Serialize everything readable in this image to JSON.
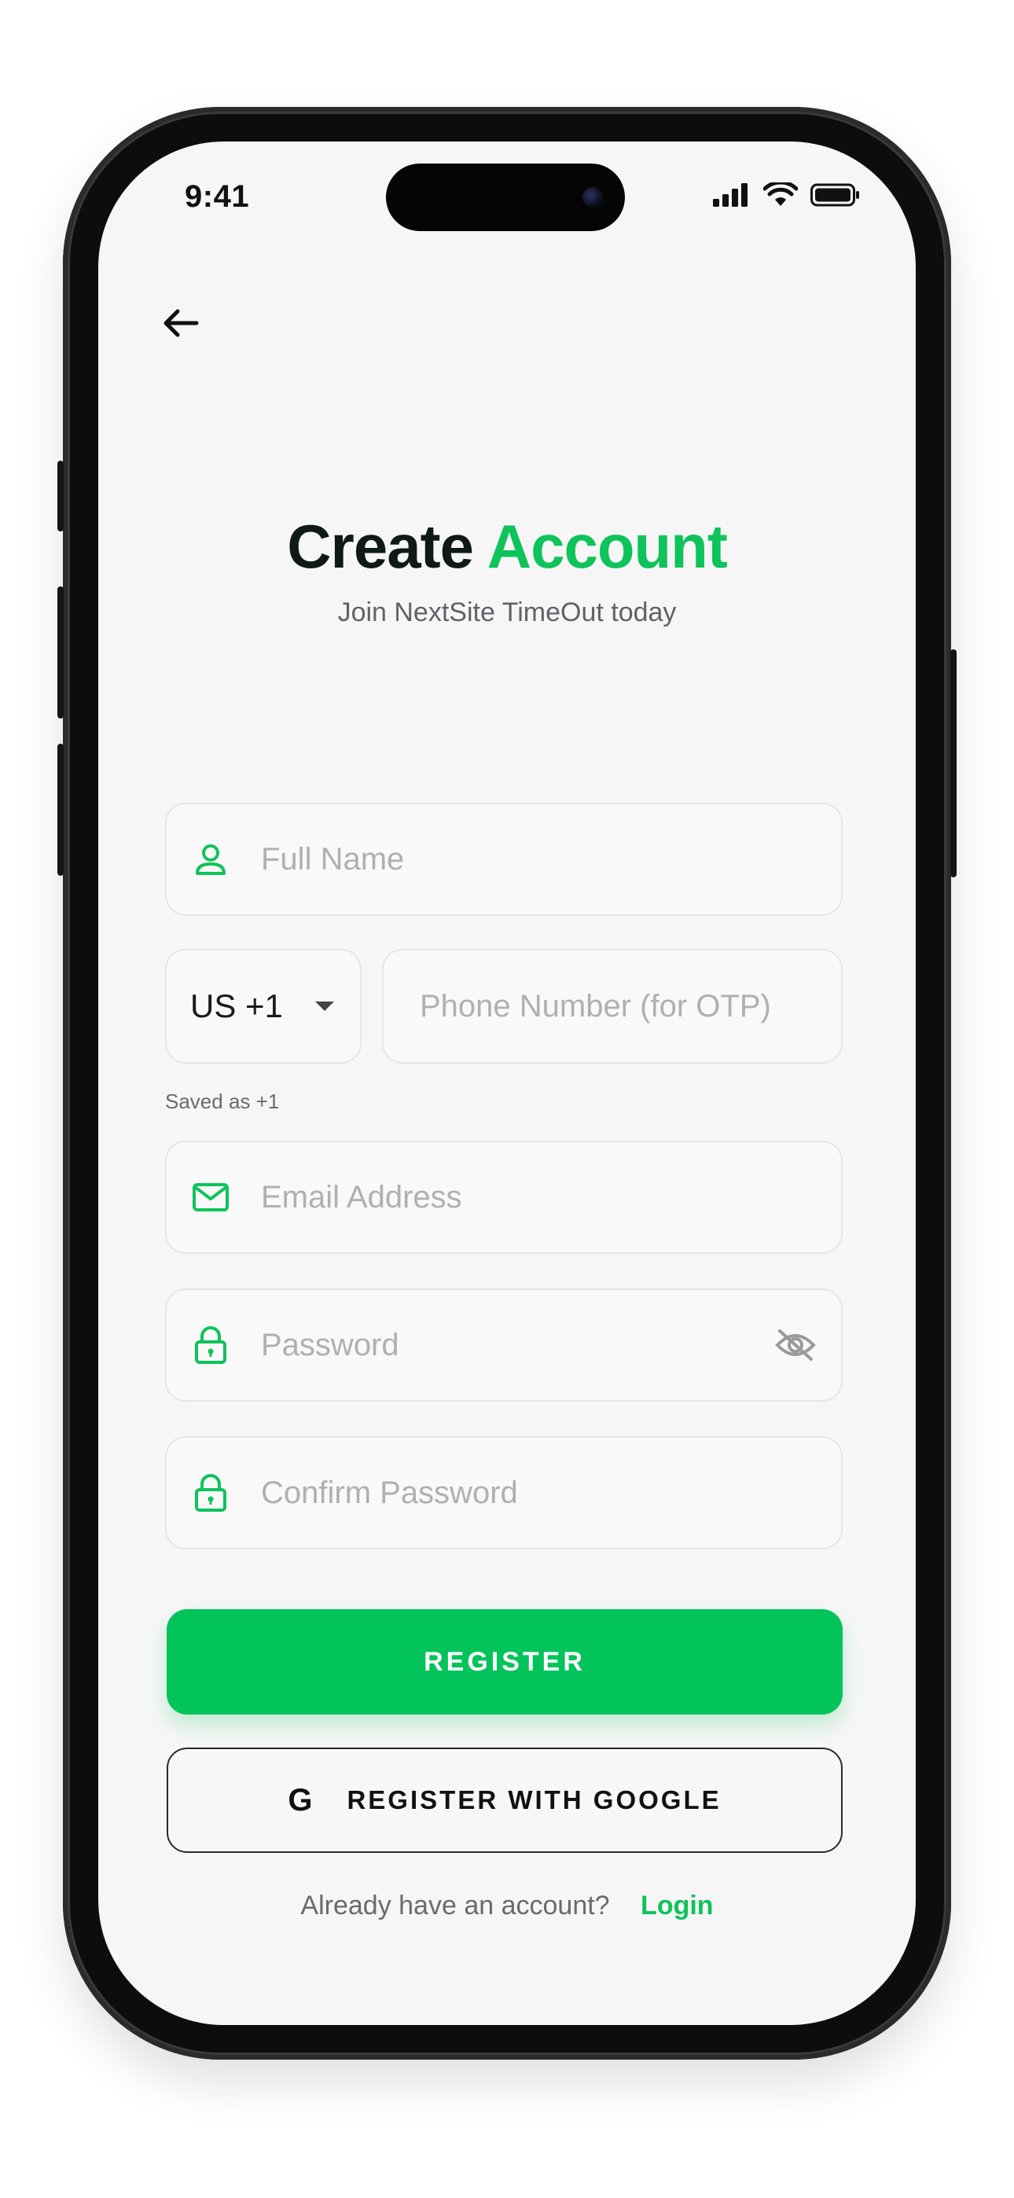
{
  "status_bar": {
    "time": "9:41"
  },
  "header": {
    "title_part1": "Create",
    "title_part2": "Account",
    "subtitle": "Join NextSite TimeOut today"
  },
  "form": {
    "full_name": {
      "placeholder": "Full Name",
      "value": ""
    },
    "country_code": {
      "selected": "US +1"
    },
    "phone": {
      "placeholder": "Phone Number (for OTP)",
      "value": ""
    },
    "phone_hint": "Saved as +1",
    "email": {
      "placeholder": "Email Address",
      "value": ""
    },
    "password": {
      "placeholder": "Password",
      "value": ""
    },
    "confirm_password": {
      "placeholder": "Confirm Password",
      "value": ""
    }
  },
  "actions": {
    "register_label": "REGISTER",
    "google_label": "REGISTER WITH GOOGLE",
    "google_glyph": "G"
  },
  "footer": {
    "question": "Already have an account?",
    "login_label": "Login"
  },
  "colors": {
    "accent": "#03c35b",
    "text_dark": "#0f1a15",
    "placeholder": "#b0b0b0"
  },
  "icons": [
    "back-arrow-icon",
    "cellular-signal-icon",
    "wifi-icon",
    "battery-icon",
    "user-icon",
    "chevron-down-icon",
    "mail-icon",
    "lock-icon",
    "eye-off-icon",
    "google-icon"
  ]
}
